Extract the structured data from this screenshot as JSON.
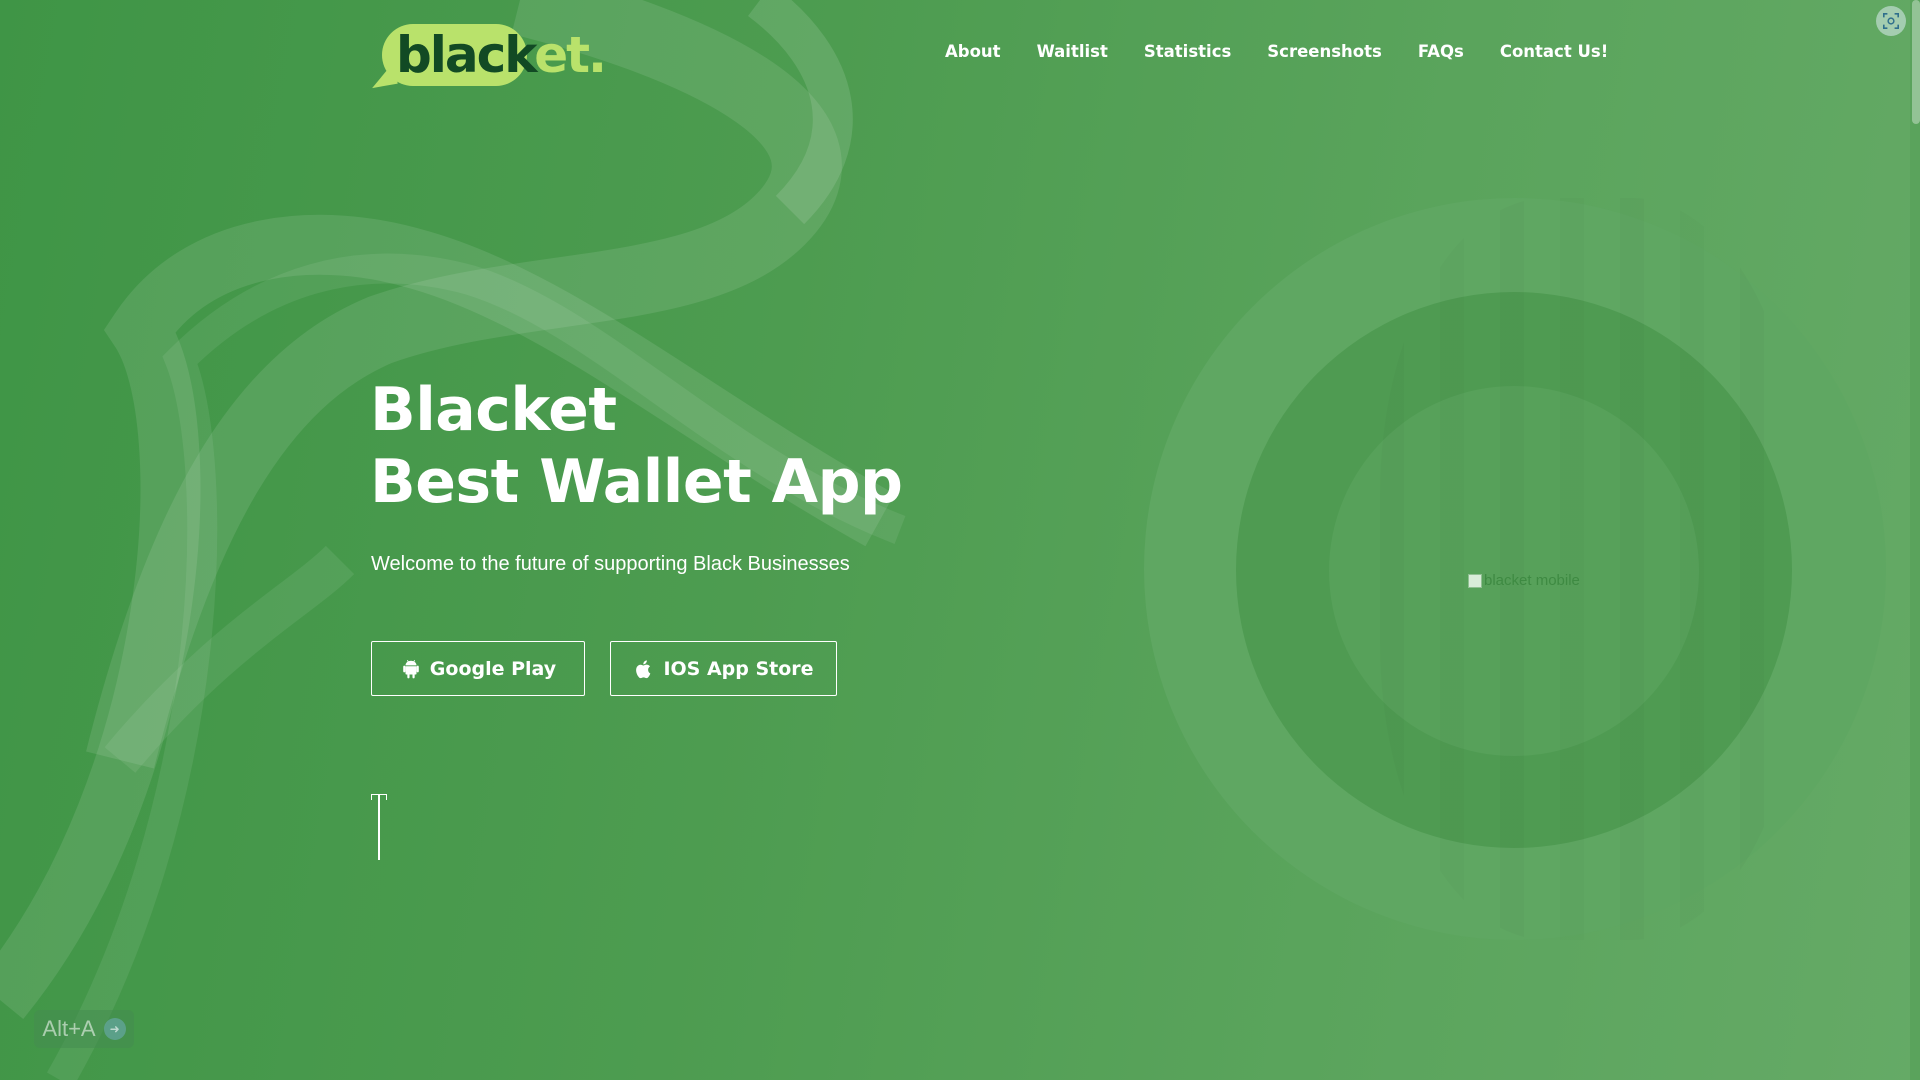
{
  "colors": {
    "background": "#4d9c50",
    "accent": "#b9e26b",
    "logo_dark": "#124a24",
    "text": "#ffffff"
  },
  "header": {
    "logo": {
      "part1": "black",
      "part2": "et",
      "dot": "."
    },
    "nav": [
      "About",
      "Waitlist",
      "Statistics",
      "Screenshots",
      "FAQs",
      "Contact Us!"
    ],
    "corner_icon": "screenshot-icon"
  },
  "hero": {
    "title_line1": "Blacket",
    "title_line2": "Best Wallet App",
    "subtitle": "Welcome to the future of supporting Black Businesses",
    "buttons": {
      "google": {
        "label": "Google Play",
        "icon": "android-icon"
      },
      "ios": {
        "label": "IOS App Store",
        "icon": "apple-icon"
      }
    }
  },
  "phone_image": {
    "alt": "blacket mobile"
  },
  "shortcut_badge": {
    "label": "Alt+A"
  }
}
